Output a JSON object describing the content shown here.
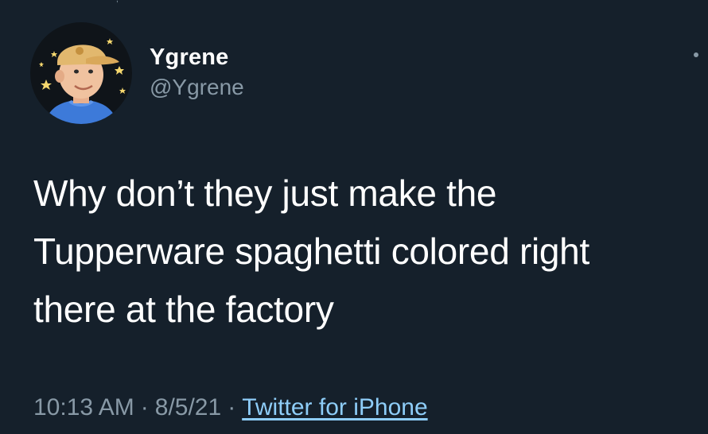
{
  "tweet": {
    "author": {
      "display_name": "Ygrene",
      "handle": "@Ygrene",
      "avatar_icon": "avatar-cartoon-cap-icon"
    },
    "text_lines": [
      "Why don’t they just make the",
      "Tupperware spaghetti colored right",
      "there at the factory"
    ],
    "meta": {
      "time": "10:13 AM",
      "separator": "·",
      "date": "8/5/21",
      "source": "Twitter for iPhone"
    },
    "more_icon": "more-options-icon"
  },
  "colors": {
    "background": "#15202b",
    "text_primary": "#ffffff",
    "text_secondary": "#8899a6",
    "link": "#8ecdf8"
  }
}
